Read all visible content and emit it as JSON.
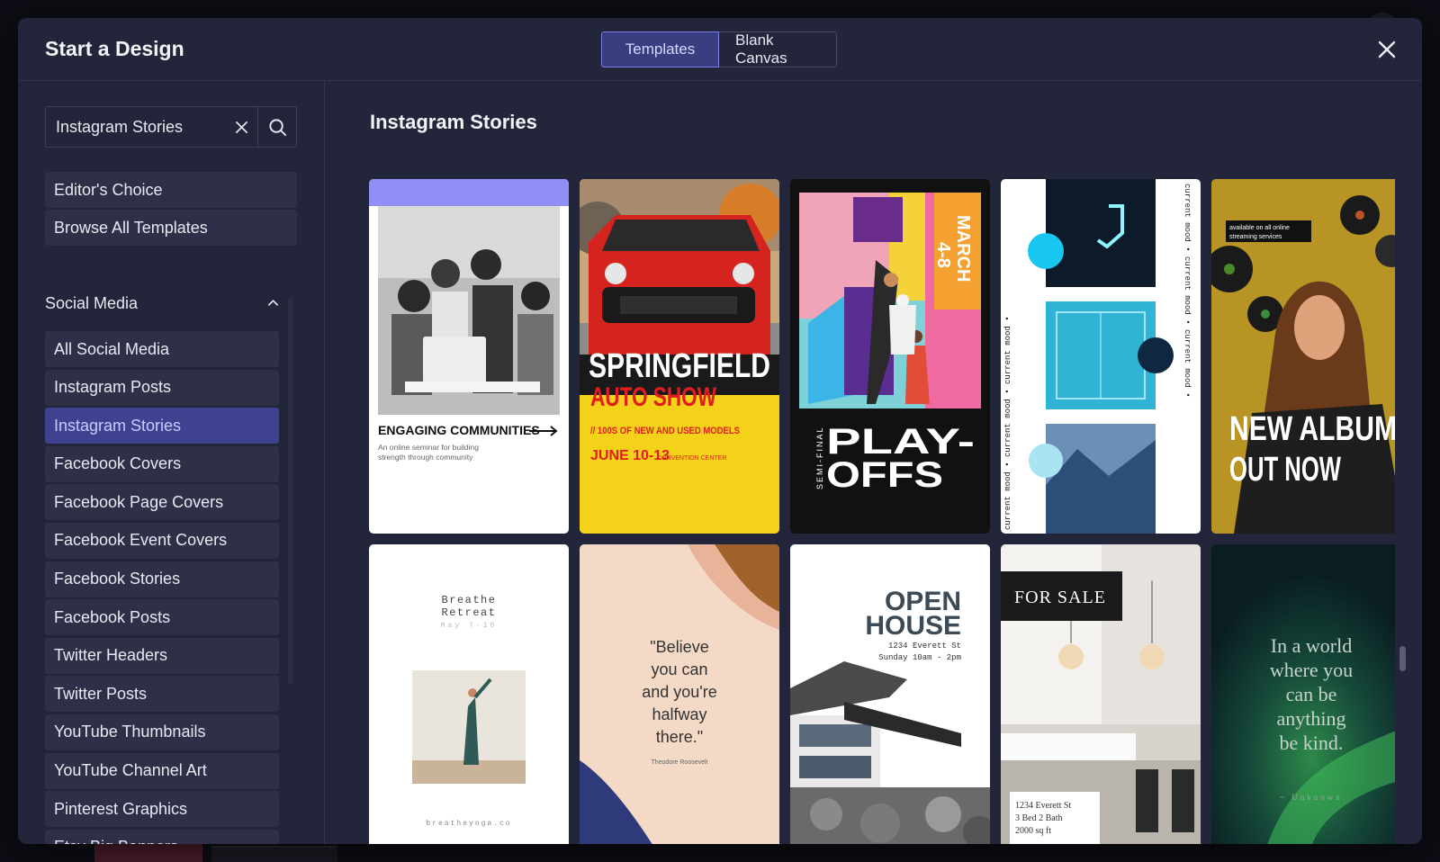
{
  "modal": {
    "title": "Start a Design",
    "tabs": [
      {
        "label": "Templates",
        "active": true
      },
      {
        "label": "Blank Canvas",
        "active": false
      }
    ],
    "close_icon": "close-icon"
  },
  "search": {
    "value": "Instagram Stories",
    "clear_icon": "clear-icon",
    "search_icon": "search-icon"
  },
  "sidebar": {
    "top_items": [
      "Editor's Choice",
      "Browse All Templates"
    ],
    "section": {
      "label": "Social Media",
      "expanded": true,
      "items": [
        "All Social Media",
        "Instagram Posts",
        "Instagram Stories",
        "Facebook Covers",
        "Facebook Page Covers",
        "Facebook Event Covers",
        "Facebook Stories",
        "Facebook Posts",
        "Twitter Headers",
        "Twitter Posts",
        "YouTube Thumbnails",
        "YouTube Channel Art",
        "Pinterest Graphics",
        "Etsy Big Banners"
      ],
      "selected": "Instagram Stories"
    }
  },
  "main": {
    "title": "Instagram Stories",
    "templates": {
      "t1": {
        "heading": "ENGAGING COMMUNITIES",
        "sub1": "An online seminar for building",
        "sub2": "strength through community"
      },
      "t2": {
        "line1": "SPRINGFIELD",
        "line2": "AUTO SHOW",
        "line3": "// 100S OF NEW AND USED MODELS",
        "date": "JUNE 10-13",
        "venue": "CONVENTION CENTER"
      },
      "t3": {
        "line1": "PLAY-",
        "line2": "OFFS",
        "side": "SEMI-FINAL",
        "date_a": "MARCH",
        "date_b": "4-8"
      },
      "t4": {
        "side_text": "current mood • current mood • current mood •"
      },
      "t5": {
        "small1": "available on all online",
        "small2": "streaming services",
        "line1": "NEW ALBUM",
        "line2": "OUT NOW"
      },
      "t6": {
        "line1": "Breathe",
        "line2": "Retreat",
        "date": "May 7-10",
        "site": "breatheyoga.co"
      },
      "t7": {
        "l1": "\"Believe",
        "l2": "you can",
        "l3": "and you're",
        "l4": "halfway",
        "l5": "there.\"",
        "author": "Theodore Roosevelt"
      },
      "t8": {
        "line1": "OPEN",
        "line2": "HOUSE",
        "addr": "1234 Everett St",
        "time": "Sunday 10am - 2pm"
      },
      "t9": {
        "tag": "FOR SALE",
        "d1": "1234 Everett St",
        "d2": "3 Bed 2 Bath",
        "d3": "2000 sq ft"
      },
      "t10": {
        "l1": "In a world",
        "l2": "where you",
        "l3": "can be",
        "l4": "anything",
        "l5": "be kind.",
        "author": "~ Unknown"
      }
    }
  },
  "colors": {
    "modal_bg": "#23253a",
    "accent": "#7c7fe8",
    "selected_item": "#3f4290",
    "item_bg": "#2e3048"
  }
}
